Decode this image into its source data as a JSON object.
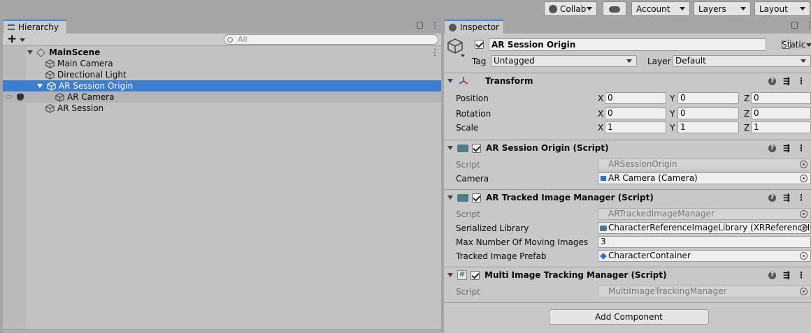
{
  "toolbar": {
    "collab_label": "Collab",
    "account_label": "Account",
    "layers_label": "Layers",
    "layout_label": "Layout"
  },
  "hierarchy": {
    "tab_label": "Hierarchy",
    "search_placeholder": "All",
    "scene_name": "MainScene",
    "items": [
      {
        "label": "Main Camera"
      },
      {
        "label": "Directional Light"
      },
      {
        "label": "AR Session Origin"
      },
      {
        "label": "AR Camera"
      },
      {
        "label": "AR Session"
      }
    ]
  },
  "inspector": {
    "tab_label": "Inspector",
    "object_name": "AR Session Origin",
    "static_label": "Static",
    "tag_label": "Tag",
    "tag_value": "Untagged",
    "layer_label": "Layer",
    "layer_value": "Default",
    "add_component_label": "Add Component",
    "transform": {
      "title": "Transform",
      "position_label": "Position",
      "rotation_label": "Rotation",
      "scale_label": "Scale",
      "x": "X",
      "y": "Y",
      "z": "Z",
      "position": [
        "0",
        "0",
        "0"
      ],
      "rotation": [
        "0",
        "0",
        "0"
      ],
      "scale": [
        "1",
        "1",
        "1"
      ]
    },
    "session_origin": {
      "title": "AR Session Origin (Script)",
      "script_label": "Script",
      "script_value": "ARSessionOrigin",
      "camera_label": "Camera",
      "camera_value": "AR Camera (Camera)"
    },
    "tracked_image_manager": {
      "title": "AR Tracked Image Manager (Script)",
      "script_label": "Script",
      "script_value": "ARTrackedImageManager",
      "library_label": "Serialized Library",
      "library_value": "CharacterReferenceImageLibrary (XRReferenceIr",
      "max_label": "Max Number Of Moving Images",
      "max_value": "3",
      "prefab_label": "Tracked Image Prefab",
      "prefab_value": "CharacterContainer"
    },
    "multi_tracking": {
      "title": "Multi Image Tracking Manager (Script)",
      "script_label": "Script",
      "script_value": "MultiImageTrackingManager"
    }
  },
  "colors": {
    "selection": "#3e7ccd",
    "accent_tab": "#4a88d6"
  }
}
